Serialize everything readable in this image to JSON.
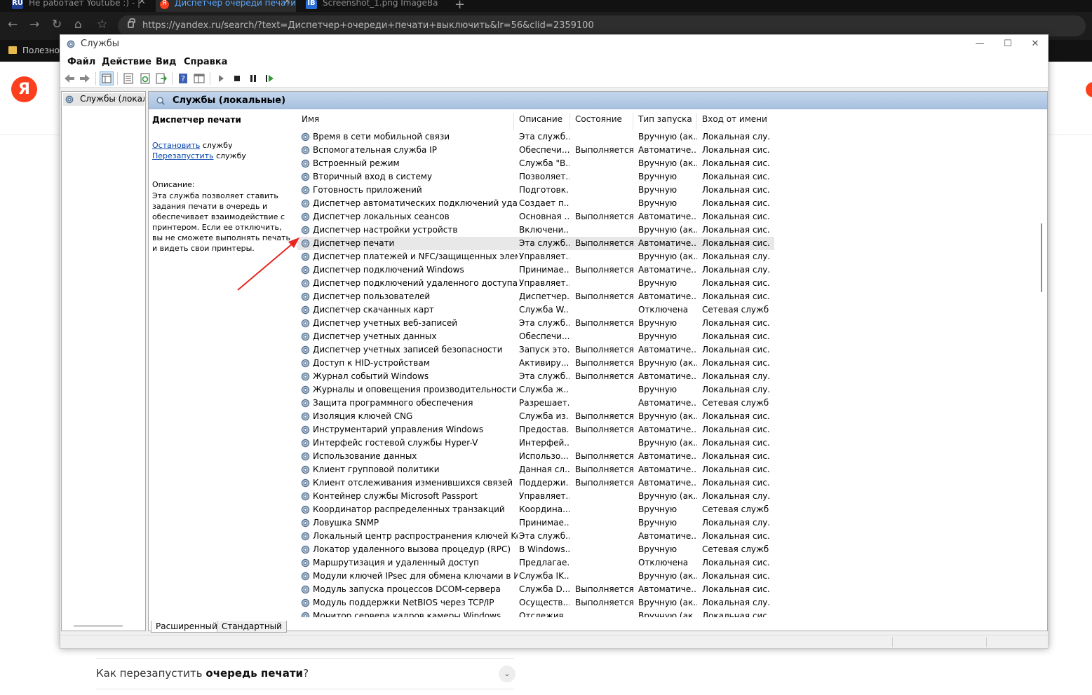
{
  "browser": {
    "tabs": [
      {
        "favicon": "RU",
        "title": "Не работает Youtube :) - |"
      },
      {
        "favicon": "Я",
        "title": "Диспетчер очереди печати"
      },
      {
        "favicon": "IB",
        "title": "Screenshot_1.png ImageBa"
      }
    ],
    "url": "https://yandex.ru/search/?text=Диспетчер+очереди+печати+выключить&lr=56&clid=2359100",
    "bookmark_label": "Полезное"
  },
  "page": {
    "logo_letter": "Я",
    "faq_question_prefix": "Как перезапустить ",
    "faq_question_bold": "очередь печати",
    "faq_question_suffix": "?"
  },
  "window": {
    "title": "Службы",
    "menu": [
      "Файл",
      "Действие",
      "Вид",
      "Справка"
    ],
    "tree_item": "Службы (локалы",
    "pane_title": "Службы (локальные)",
    "detail": {
      "title": "Диспетчер печати",
      "stop_link": "Остановить",
      "stop_suffix": " службу",
      "restart_link": "Перезапустить",
      "restart_suffix": " службу",
      "description_label": "Описание:",
      "description": "Эта служба позволяет ставить задания печати в очередь и обеспечивает взаимодействие с принтером.  Если ее отключить, вы не сможете выполнять печать и видеть свои принтеры."
    },
    "columns": [
      "Имя",
      "Описание",
      "Состояние",
      "Тип запуска",
      "Вход от имени"
    ],
    "services": [
      [
        "Время в сети мобильной связи",
        "Эта служб...",
        "",
        "Вручную (ак...",
        "Локальная слу..."
      ],
      [
        "Вспомогательная служба IP",
        "Обеспечи...",
        "Выполняется",
        "Автоматиче...",
        "Локальная сис..."
      ],
      [
        "Встроенный режим",
        "Служба \"В...",
        "",
        "Вручную (ак...",
        "Локальная сис..."
      ],
      [
        "Вторичный вход в систему",
        "Позволяет...",
        "",
        "Вручную",
        "Локальная сис..."
      ],
      [
        "Готовность приложений",
        "Подготовк...",
        "",
        "Вручную",
        "Локальная сис..."
      ],
      [
        "Диспетчер автоматических подключений удаленн...",
        "Создает п...",
        "",
        "Вручную",
        "Локальная сис..."
      ],
      [
        "Диспетчер локальных сеансов",
        "Основная ...",
        "Выполняется",
        "Автоматиче...",
        "Локальная сис..."
      ],
      [
        "Диспетчер настройки устройств",
        "Включени...",
        "",
        "Вручную (ак...",
        "Локальная сис..."
      ],
      [
        "Диспетчер печати",
        "Эта служб...",
        "Выполняется",
        "Автоматиче...",
        "Локальная сис..."
      ],
      [
        "Диспетчер платежей и NFC/защищенных элемен...",
        "Управляет...",
        "",
        "Вручную (ак...",
        "Локальная слу..."
      ],
      [
        "Диспетчер подключений Windows",
        "Принимае...",
        "Выполняется",
        "Автоматиче...",
        "Локальная слу..."
      ],
      [
        "Диспетчер подключений удаленного доступа",
        "Управляет...",
        "",
        "Вручную",
        "Локальная сис..."
      ],
      [
        "Диспетчер пользователей",
        "Диспетчер...",
        "Выполняется",
        "Автоматиче...",
        "Локальная сис..."
      ],
      [
        "Диспетчер скачанных карт",
        "Служба W...",
        "",
        "Отключена",
        "Сетевая служба"
      ],
      [
        "Диспетчер учетных веб-записей",
        "Эта служб...",
        "Выполняется",
        "Вручную",
        "Локальная сис..."
      ],
      [
        "Диспетчер учетных данных",
        "Обеспечи...",
        "",
        "Вручную",
        "Локальная сис..."
      ],
      [
        "Диспетчер учетных записей безопасности",
        "Запуск это...",
        "Выполняется",
        "Автоматиче...",
        "Локальная сис..."
      ],
      [
        "Доступ к HID-устройствам",
        "Активиру...",
        "Выполняется",
        "Вручную (ак...",
        "Локальная сис..."
      ],
      [
        "Журнал событий Windows",
        "Эта служб...",
        "Выполняется",
        "Автоматиче...",
        "Локальная слу..."
      ],
      [
        "Журналы и оповещения производительности",
        "Служба ж...",
        "",
        "Вручную",
        "Локальная слу..."
      ],
      [
        "Защита программного обеспечения",
        "Разрешает...",
        "",
        "Автоматиче...",
        "Сетевая служба"
      ],
      [
        "Изоляция ключей CNG",
        "Служба из...",
        "Выполняется",
        "Вручную (ак...",
        "Локальная сис..."
      ],
      [
        "Инструментарий управления Windows",
        "Предостав...",
        "Выполняется",
        "Автоматиче...",
        "Локальная сис..."
      ],
      [
        "Интерфейс гостевой службы Hyper-V",
        "Интерфей...",
        "",
        "Вручную (ак...",
        "Локальная сис..."
      ],
      [
        "Использование данных",
        "Использо...",
        "Выполняется",
        "Автоматиче...",
        "Локальная сис..."
      ],
      [
        "Клиент групповой политики",
        "Данная сл...",
        "Выполняется",
        "Автоматиче...",
        "Локальная сис..."
      ],
      [
        "Клиент отслеживания изменившихся связей",
        "Поддержи...",
        "Выполняется",
        "Автоматиче...",
        "Локальная сис..."
      ],
      [
        "Контейнер службы Microsoft Passport",
        "Управляет...",
        "",
        "Вручную (ак...",
        "Локальная слу..."
      ],
      [
        "Координатор распределенных транзакций",
        "Координа...",
        "",
        "Вручную",
        "Сетевая служба"
      ],
      [
        "Ловушка SNMP",
        "Принимае...",
        "",
        "Вручную",
        "Локальная слу..."
      ],
      [
        "Локальный центр распространения ключей Kerbe...",
        "Эта служб...",
        "",
        "Автоматиче...",
        "Локальная сис..."
      ],
      [
        "Локатор удаленного вызова процедур (RPC)",
        "В Windows...",
        "",
        "Вручную",
        "Сетевая служба"
      ],
      [
        "Маршрутизация и удаленный доступ",
        "Предлагае...",
        "",
        "Отключена",
        "Локальная сис..."
      ],
      [
        "Модули ключей IPsec для обмена ключами в Инт...",
        "Служба IK...",
        "",
        "Вручную (ак...",
        "Локальная сис..."
      ],
      [
        "Модуль запуска процессов DCOM-сервера",
        "Служба D...",
        "Выполняется",
        "Автоматиче...",
        "Локальная сис..."
      ],
      [
        "Модуль поддержки NetBIOS через TCP/IP",
        "Осуществ...",
        "Выполняется",
        "Вручную (ак...",
        "Локальная слу..."
      ],
      [
        "Монитор сервера кадров камеры Windows",
        "Отслежив...",
        "",
        "Вручную (ак...",
        "Локальная сис..."
      ]
    ],
    "selected_service": "Диспетчер печати",
    "bottom_tabs": [
      "Расширенный",
      "Стандартный"
    ]
  },
  "colors": {
    "annotation_arrow": "#e8261f",
    "link": "#0645ad",
    "header_gradient_top": "#c4d6ec",
    "brand": "#fc3f1d"
  }
}
